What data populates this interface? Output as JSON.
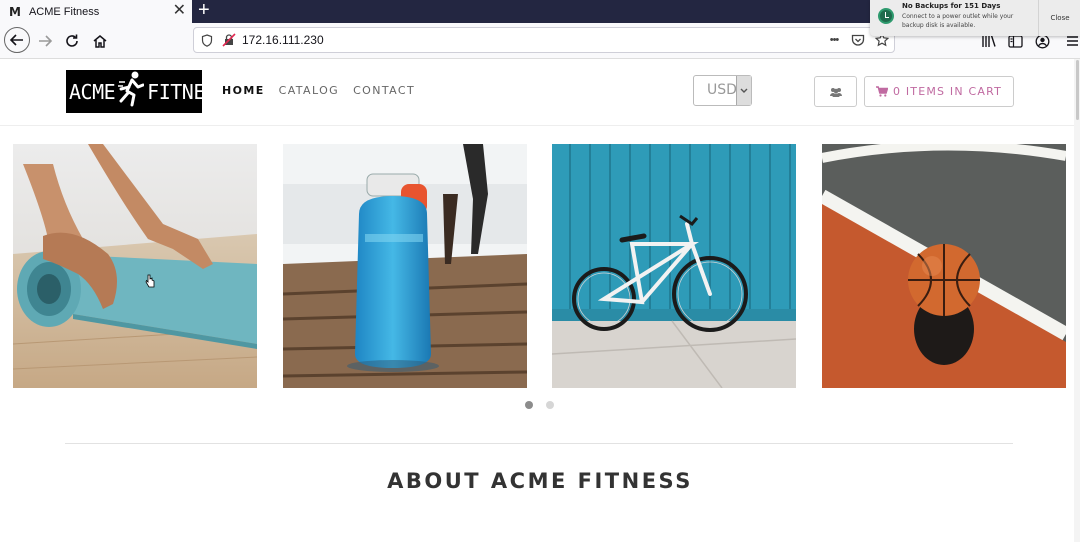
{
  "browser": {
    "tab_favicon": "M",
    "tab_title": "ACME Fitness",
    "tab_close": "✕",
    "new_tab": "+",
    "url": "172.16.111.230",
    "page_actions": "•••"
  },
  "notification": {
    "title": "No Backups for 151 Days",
    "body": "Connect to a power outlet while your backup disk is available.",
    "close_label": "Close"
  },
  "site": {
    "logo_left": "ACME",
    "logo_right": "FITNESS",
    "nav": {
      "home": "HOME",
      "catalog": "CATALOG",
      "contact": "CONTACT"
    },
    "currency": "USD",
    "cart_label": "0 ITEMS IN CART",
    "about_heading": "ABOUT ACME FITNESS"
  },
  "products": [
    {
      "name": "yoga-mat"
    },
    {
      "name": "water-bottle"
    },
    {
      "name": "bicycle"
    },
    {
      "name": "basketball"
    }
  ],
  "carousel": {
    "pages": 2,
    "active_page": 1
  },
  "colors": {
    "brand_pink": "#c06aa1",
    "tab_bar": "#232641",
    "dot_active": "#8c8c8c",
    "dot_inactive": "#d6d6d6"
  }
}
